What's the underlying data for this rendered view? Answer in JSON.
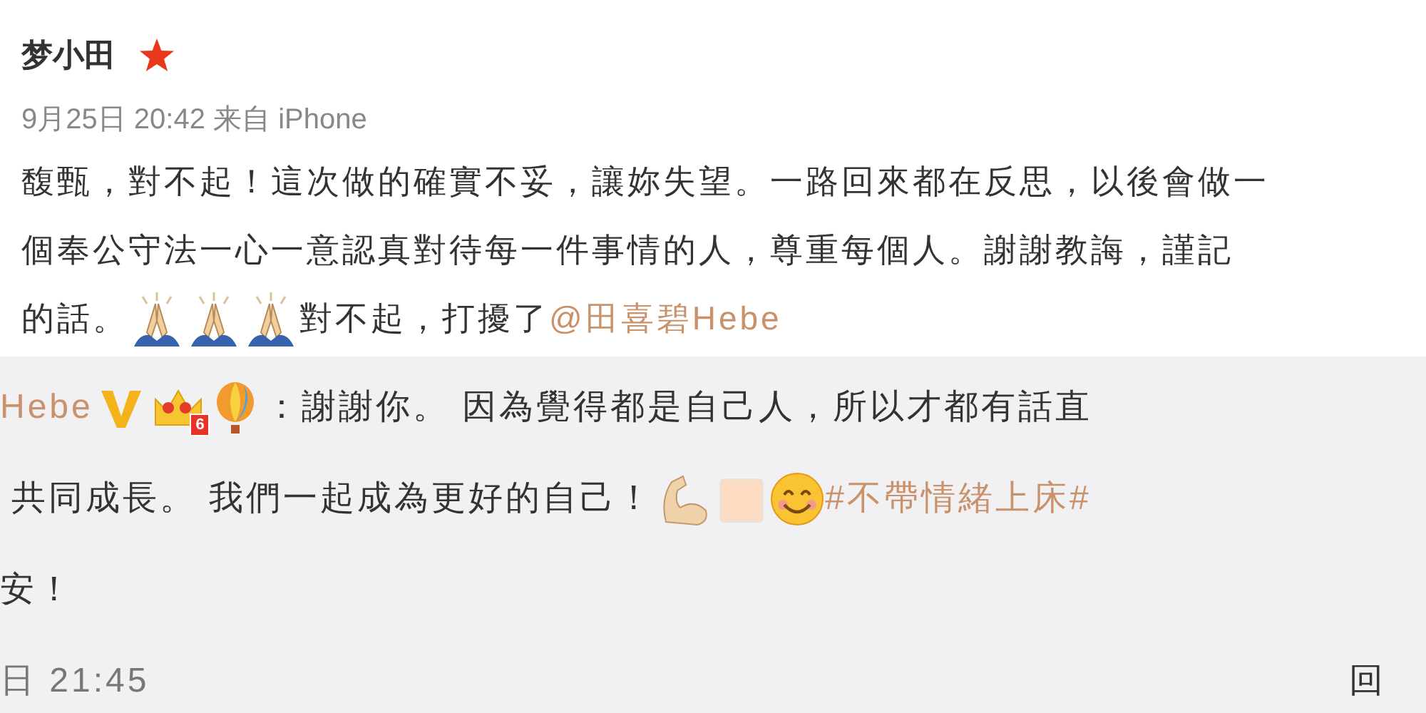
{
  "post": {
    "author": "梦小田",
    "meta": "9月25日 20:42 来自 iPhone",
    "lines": [
      [
        {
          "kind": "text",
          "text": "馥甄，對不起！這次做的確實不妥，讓妳失望。一路回來都在反思，以後會做一"
        }
      ],
      [
        {
          "kind": "text",
          "text": "個奉公守法一心一意認真對待每一件事情的人，尊重每個人。謝謝教誨，謹記"
        }
      ],
      [
        {
          "kind": "text",
          "text": "的話。"
        },
        {
          "kind": "pray"
        },
        {
          "kind": "pray"
        },
        {
          "kind": "pray"
        },
        {
          "kind": "text",
          "text": "對不起，打擾了"
        },
        {
          "kind": "link",
          "text": "@田喜碧Hebe"
        }
      ]
    ]
  },
  "reply": {
    "lines": [
      [
        {
          "kind": "link",
          "text": "Hebe"
        },
        {
          "kind": "vip"
        },
        {
          "kind": "crown",
          "text": "6"
        },
        {
          "kind": "balloon"
        },
        {
          "kind": "text",
          "text": "：謝謝你。 因為覺得都是自己人，所以才都有話直"
        }
      ],
      [
        {
          "kind": "text",
          "text": "共同成長。 我們一起成為更好的自己！"
        },
        {
          "kind": "muscle"
        },
        {
          "kind": "blank"
        },
        {
          "kind": "smile"
        },
        {
          "kind": "link",
          "text": "#不帶情緒上床#"
        }
      ],
      [
        {
          "kind": "text",
          "text": "安！"
        }
      ]
    ],
    "time": "日 21:45",
    "action": "回"
  }
}
